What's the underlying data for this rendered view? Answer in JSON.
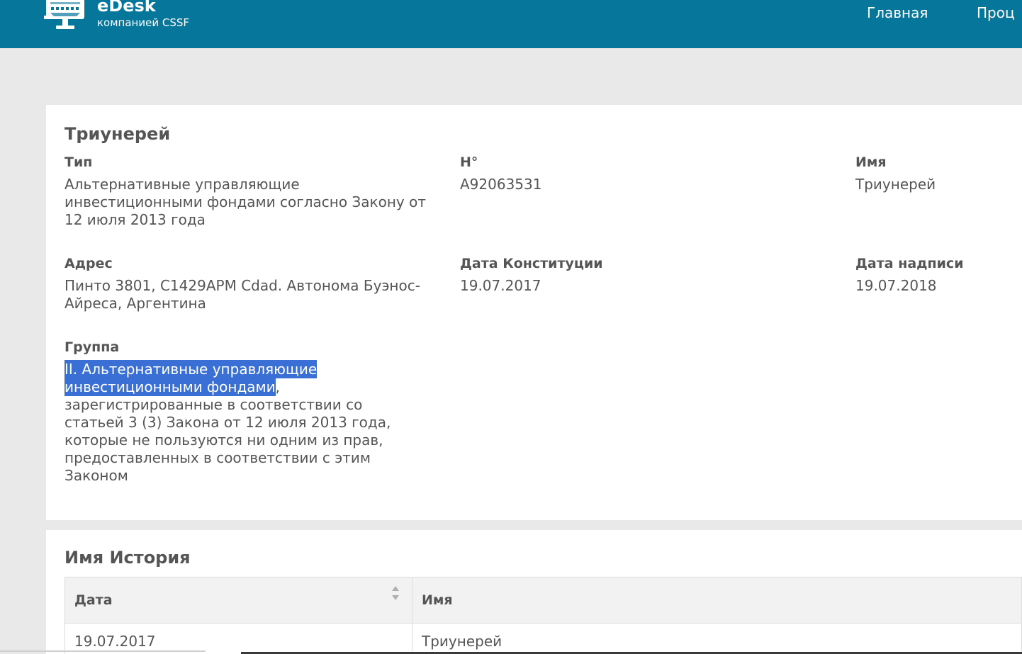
{
  "colors": {
    "header_bg": "#07769b",
    "page_bg": "#e9e9e9",
    "card_bg": "#ffffff",
    "text": "#555555",
    "selection_bg": "#3a6fd6",
    "selection_text": "#ffffff",
    "table_header_bg": "#f2f2f2"
  },
  "header": {
    "logo_icon": "desk-monitor-icon",
    "brand_name": "eDesk",
    "brand_subtitle": "компанией CSSF",
    "nav": [
      {
        "label": "Главная"
      },
      {
        "label": "Проц"
      }
    ]
  },
  "entity": {
    "title": "Триунерей",
    "fields": [
      {
        "label": "Тип",
        "value": "Альтернативные управляющие инвестиционными фондами согласно Закону от 12 июля 2013 года"
      },
      {
        "label": "Н°",
        "value": "A92063531"
      },
      {
        "label": "Имя",
        "value": "Триунерей"
      },
      {
        "label": "Адрес",
        "value": "Пинто 3801, C1429APM Cdad. Автонома Буэнос-Айреса, Аргентина"
      },
      {
        "label": "Дата Конституции",
        "value": "19.07.2017"
      },
      {
        "label": "Дата надписи",
        "value": "19.07.2018"
      }
    ],
    "group": {
      "label": "Группа",
      "value_selected": "II. Альтернативные управляющие инвестиционными фондами",
      "value_rest": ", зарегистрированные в соответствии со статьей 3 (3) Закона от 12 июля 2013 года, которые не пользуются ни одним из прав, предоставленных в соответствии с этим Законом"
    }
  },
  "history": {
    "title": "Имя История",
    "columns": [
      {
        "label": "Дата",
        "sort_icon": "sort-icon"
      },
      {
        "label": "Имя"
      }
    ],
    "rows": [
      {
        "date": "19.07.2017",
        "name": "Триунерей"
      }
    ]
  }
}
